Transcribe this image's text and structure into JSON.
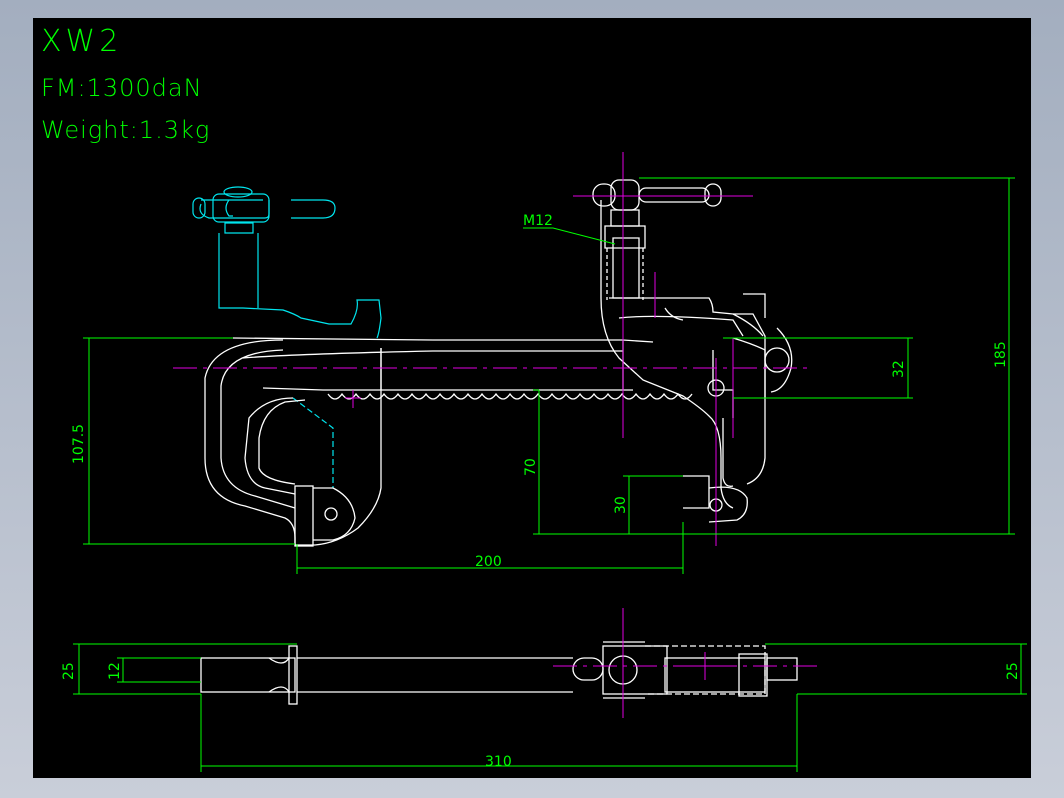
{
  "header": {
    "title": "XW2",
    "force": "FM:1300daN",
    "weight": "Weight:1.3kg"
  },
  "dimensions": {
    "total_height": "185",
    "jaw_opening": "107.5",
    "offset_32": "32",
    "depth_70": "70",
    "depth_30": "30",
    "throat": "200",
    "thread": "M12",
    "width_left": "25",
    "width_inner": "12",
    "width_right": "25",
    "total_length": "310"
  },
  "colors": {
    "background": "#000000",
    "outline": "#ffffff",
    "dimension": "#00ff00",
    "centerline": "#e000e0",
    "ghost": "#00e5ee"
  }
}
